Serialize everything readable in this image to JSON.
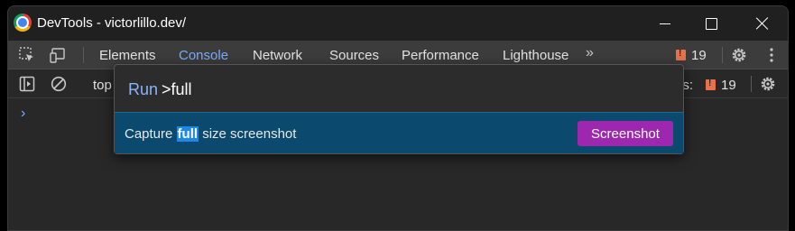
{
  "window": {
    "title": "DevTools - victorlillo.dev/"
  },
  "tabs": [
    {
      "label": "Elements"
    },
    {
      "label": "Console",
      "active": true
    },
    {
      "label": "Network"
    },
    {
      "label": "Sources"
    },
    {
      "label": "Performance"
    },
    {
      "label": "Lighthouse"
    }
  ],
  "more_tabs_glyph": "»",
  "issues_count": "19",
  "console_toolbar": {
    "context": "top",
    "issues_label": "es:",
    "issues_count": "19"
  },
  "prompt_glyph": "›",
  "command_menu": {
    "prefix": "Run",
    "query": ">full",
    "result": {
      "before": "Capture ",
      "match": "full",
      "after": " size screenshot",
      "category": "Screenshot"
    }
  },
  "colors": {
    "accent": "#7cacf8",
    "selected_row": "#0b4a6e",
    "category_badge": "#9e27b0",
    "issue_badge": "#e8724a"
  },
  "icons": [
    "chrome-logo-icon",
    "minimize-icon",
    "maximize-icon",
    "close-icon",
    "inspect-element-icon",
    "device-toggle-icon",
    "more-tabs-icon",
    "issue-badge-icon",
    "settings-icon",
    "kebab-menu-icon",
    "sidebar-toggle-icon",
    "clear-console-icon",
    "console-prompt-icon"
  ]
}
